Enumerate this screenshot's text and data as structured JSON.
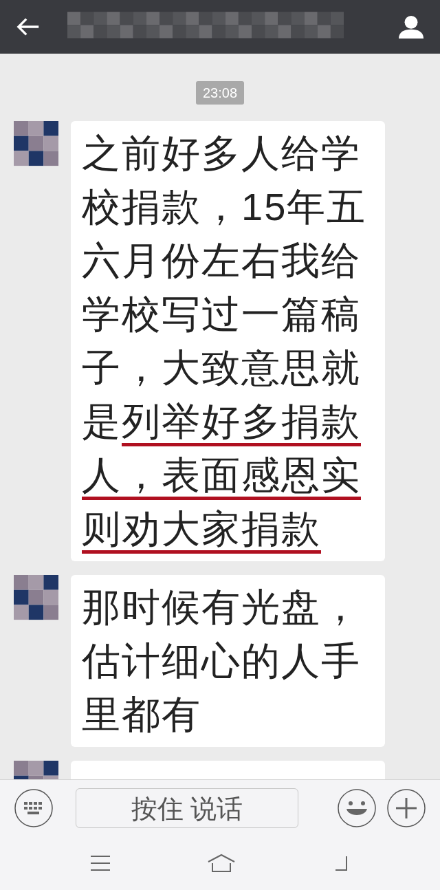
{
  "time_badge": "23:08",
  "messages": [
    {
      "kind": "text",
      "segments": [
        {
          "text": "之前好多人给学校捐款，15年五六月份左右我给学校写过一篇稿子，大致意思就是",
          "underlined": false
        },
        {
          "text": "列举好多捐款人，表面感恩实则劝大家捐款",
          "underlined": true
        }
      ]
    },
    {
      "kind": "text",
      "segments": [
        {
          "text": "那时候有光盘，估计细心的人手里都有",
          "underlined": false
        }
      ]
    },
    {
      "kind": "cut_off"
    }
  ],
  "input_bar": {
    "hold_to_talk": "按住 说话"
  }
}
